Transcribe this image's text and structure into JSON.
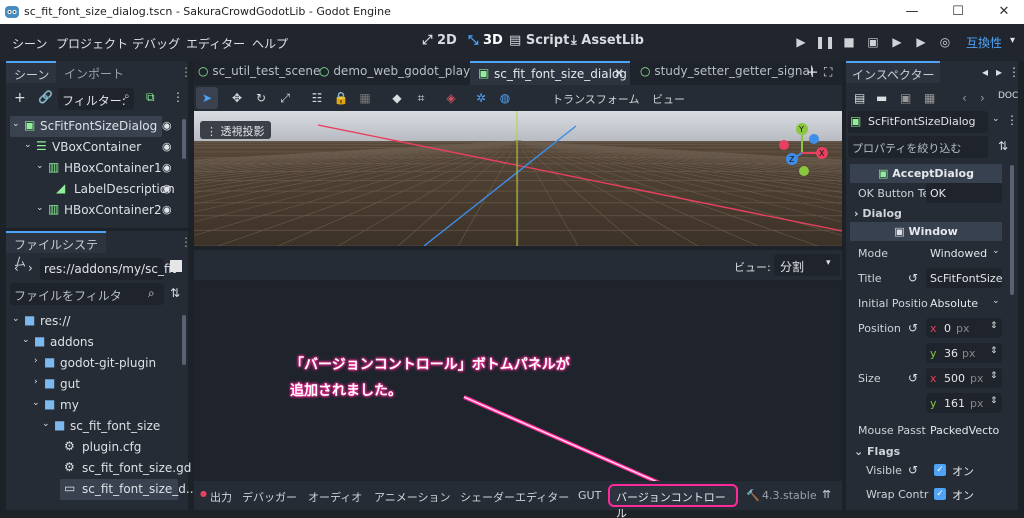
{
  "window": {
    "title": "sc_fit_font_size_dialog.tscn - SakuraCrowdGodotLib - Godot Engine",
    "controls": [
      "—",
      "☐",
      "✕"
    ]
  },
  "menu": [
    "シーン",
    "プロジェクト",
    "デバッグ",
    "エディター",
    "ヘルプ"
  ],
  "modes": [
    "2D",
    "3D",
    "Script",
    "AssetLib"
  ],
  "renderer": "互換性",
  "scene_panel": {
    "tabs": [
      "シーン",
      "インポート"
    ],
    "filter": "フィルター:",
    "nodes": [
      "ScFitFontSizeDialog",
      "VBoxContainer",
      "HBoxContainer1",
      "LabelDescription",
      "HBoxContainer2"
    ]
  },
  "fs_panel": {
    "tab": "ファイルシステム",
    "path": "res://addons/my/sc_fit",
    "filter": "ファイルをフィルタ",
    "items": [
      "res://",
      "addons",
      "godot-git-plugin",
      "gut",
      "my",
      "sc_fit_font_size",
      "plugin.cfg",
      "sc_fit_font_size.gd",
      "sc_fit_font_size_d..."
    ]
  },
  "editor_tabs": [
    "sc_util_test_scene",
    "demo_web_godot_player",
    "sc_fit_font_size_dialog",
    "study_setter_getter_signal"
  ],
  "toolbar": {
    "transform": "トランスフォーム",
    "view": "ビュー"
  },
  "viewport": {
    "label": "透視投影"
  },
  "vc": {
    "view_label": "ビュー:",
    "view_value": "分割"
  },
  "annotation": {
    "line1": "「バージョンコントロール」ボトムパネルが",
    "line2": "追加されました。"
  },
  "bottom": {
    "items": [
      "出力",
      "デバッガー",
      "オーディオ",
      "アニメーション",
      "シェーダーエディター",
      "GUT"
    ],
    "active": "バージョンコントロール",
    "version": "4.3.stable"
  },
  "inspector": {
    "tab": "インスペクター",
    "node": "ScFitFontSizeDialog",
    "filter": "プロパティを絞り込む",
    "class": "AcceptDialog",
    "ok_label": "OK Button Te",
    "ok_value": "OK",
    "dialog": "Dialog",
    "window": "Window",
    "mode_label": "Mode",
    "mode_value": "Windowed",
    "title_label": "Title",
    "title_value": "ScFitFontSize",
    "initpos_label": "Initial Positio",
    "initpos_value": "Absolute",
    "pos_label": "Position",
    "pos_x": "0",
    "pos_y": "36",
    "size_label": "Size",
    "size_x": "500",
    "size_y": "161",
    "px": "px",
    "mouse_label": "Mouse Passt",
    "mouse_value": "PackedVecto",
    "flags": "Flags",
    "visible_label": "Visible",
    "visible_value": "オン",
    "wrap_label": "Wrap Contr",
    "wrap_value": "オン"
  },
  "colors": {
    "accent": "#4ea3f7",
    "annotation": "#ff2a9a"
  }
}
